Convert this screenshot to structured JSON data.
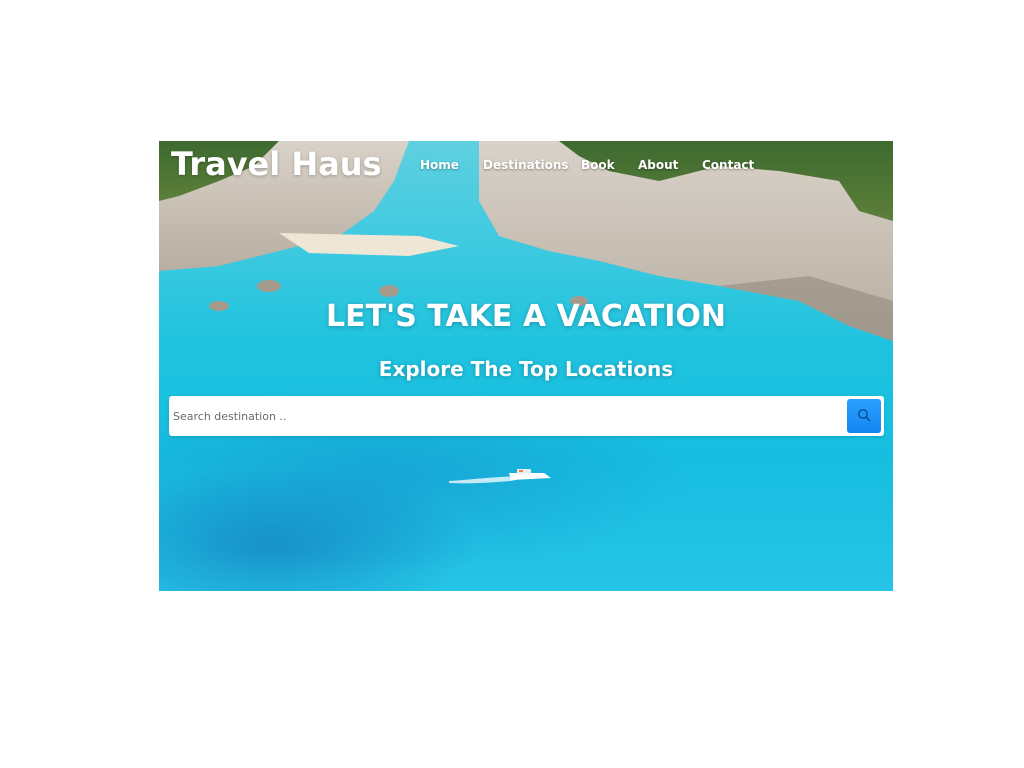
{
  "header": {
    "brand": "Travel Haus",
    "nav": [
      {
        "label": "Home"
      },
      {
        "label": "Destinations"
      },
      {
        "label": "Book"
      },
      {
        "label": "About"
      },
      {
        "label": "Contact"
      }
    ]
  },
  "hero": {
    "headline": "LET'S TAKE A VACATION",
    "subline": "Explore The Top Locations",
    "search": {
      "placeholder": "Search destination ..",
      "value": "",
      "button_icon": "search-icon"
    }
  },
  "colors": {
    "accent": "#1386f0",
    "water": "#17bde0",
    "text_on_hero": "#ffffff"
  }
}
